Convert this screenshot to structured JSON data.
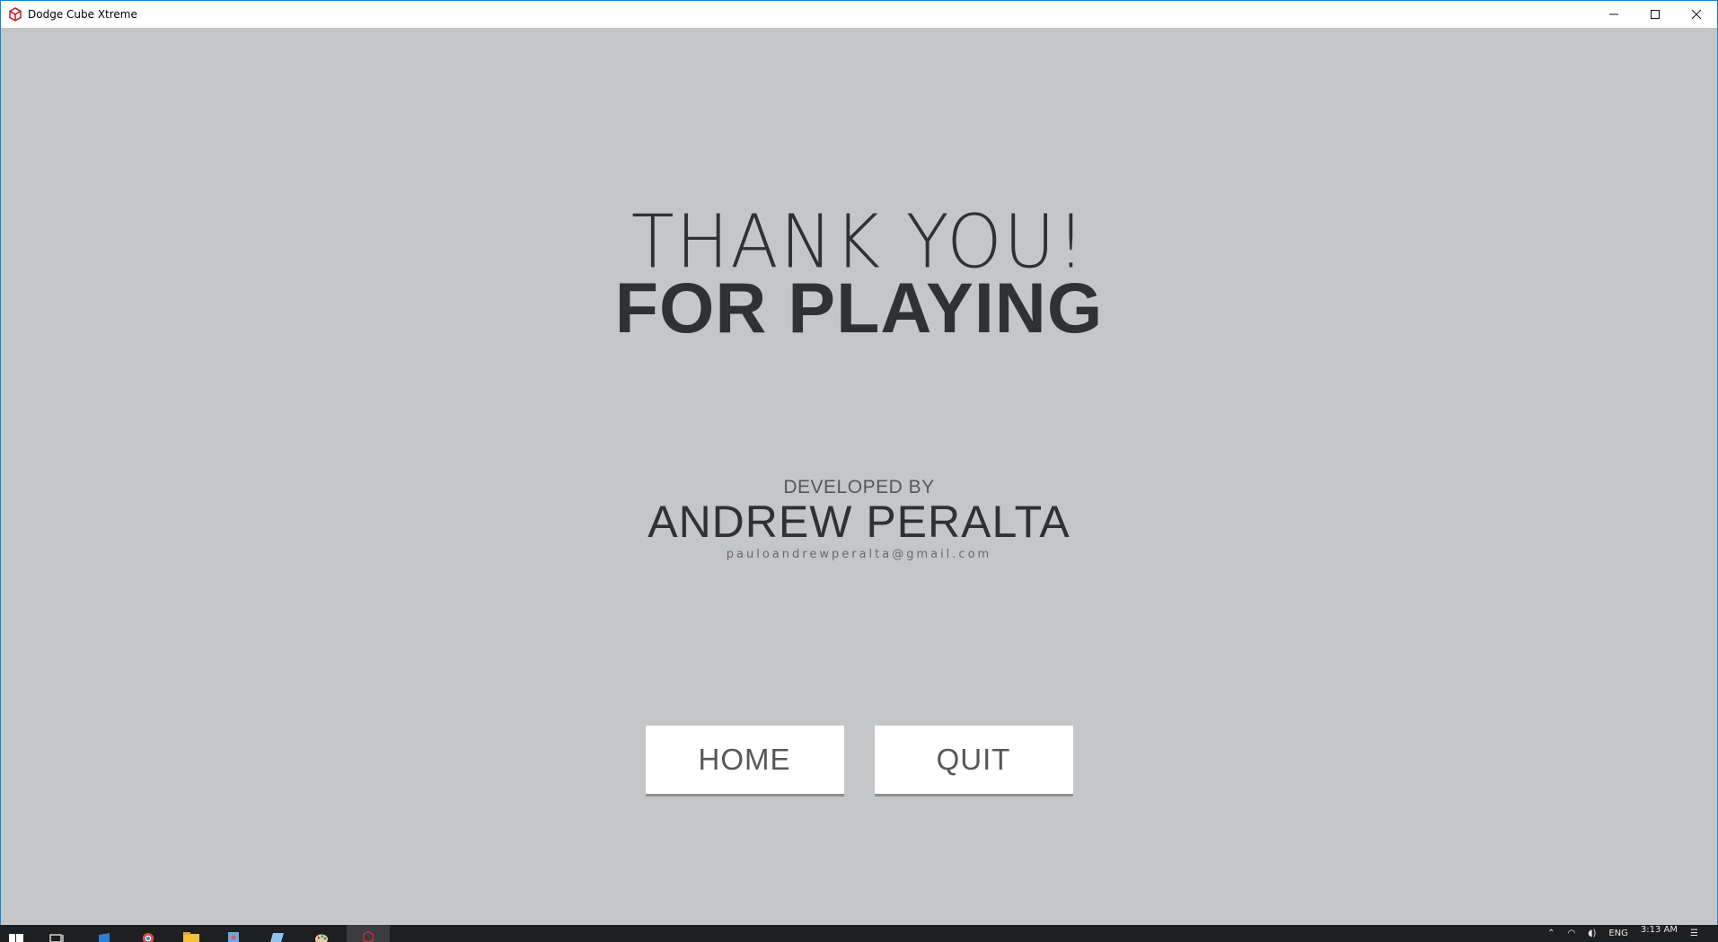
{
  "window": {
    "title": "Dodge Cube Xtreme",
    "controls": {
      "minimize": "—",
      "maximize": "☐",
      "close": "✕"
    }
  },
  "screen": {
    "thanks_line1": "THANK YOU!",
    "thanks_line2": "FOR PLAYING",
    "developed_by_label": "DEVELOPED BY",
    "developer_name": "ANDREW PERALTA",
    "developer_email": "pauloandrewperalta@gmail.com"
  },
  "buttons": {
    "home_label": "HOME",
    "quit_label": "QUIT"
  },
  "taskbar": {
    "lang": "ENG",
    "time": "3:13 AM",
    "icons": [
      "windows-start-icon",
      "task-view-icon",
      "bookmark-app-icon",
      "chrome-icon",
      "file-explorer-icon",
      "photo-app-icon",
      "notepad-app-icon",
      "paint-app-icon",
      "dodge-cube-app-icon"
    ]
  },
  "colors": {
    "background": "#c5c6c8",
    "text_dark": "#2f3133",
    "button_bg": "#ffffff",
    "accent_border": "#1883d7",
    "taskbar": "#1e1f21"
  }
}
